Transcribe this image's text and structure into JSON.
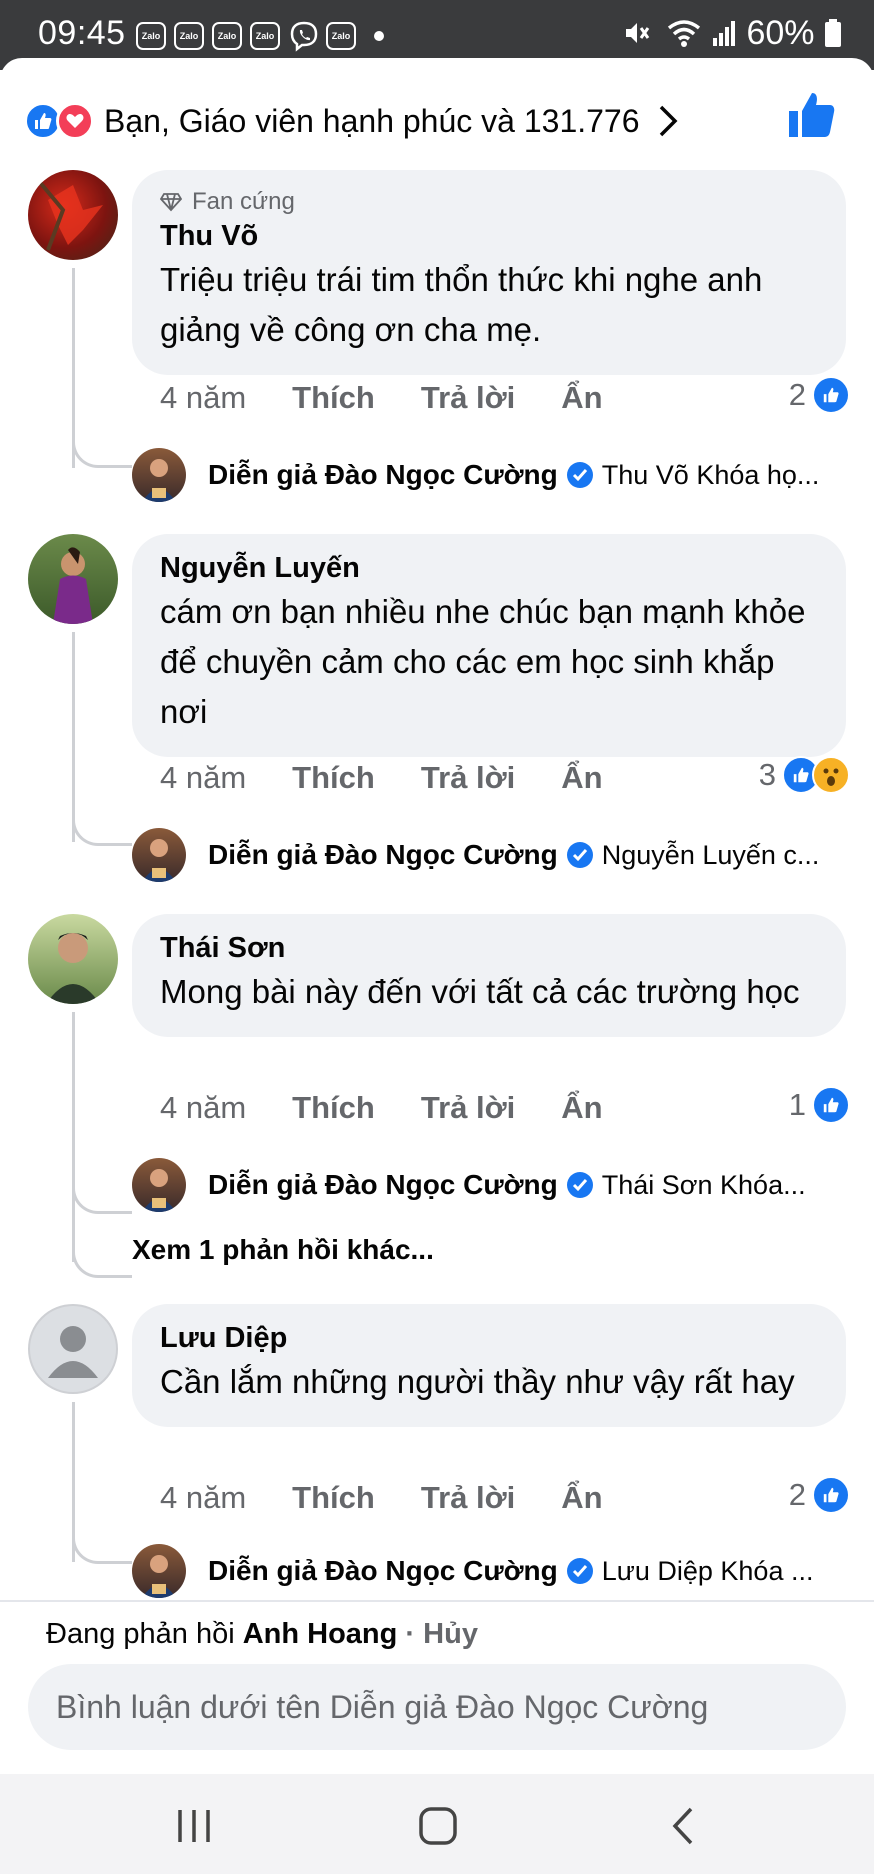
{
  "status": {
    "time": "09:45",
    "notif_icons": [
      "Zalo",
      "Zalo",
      "Zalo",
      "Zalo",
      "viber-icon",
      "Zalo"
    ],
    "battery": "60%"
  },
  "reactions_bar": {
    "text": "Bạn, Giáo viên hạnh phúc và 131.776"
  },
  "comments": [
    {
      "badge": "Fan cứng",
      "name": "Thu Võ",
      "body": "Triệu triệu trái tim thổn thức khi nghe anh giảng về công ơn cha mẹ.",
      "time": "4 năm",
      "like": "Thích",
      "reply": "Trả lời",
      "hide": "Ẩn",
      "count": "2",
      "reply_item": {
        "name": "Diễn giả Đào Ngọc Cường",
        "text": "Thu Võ Khóa họ..."
      }
    },
    {
      "name": "Nguyễn Luyến",
      "body": "cám ơn bạn nhiều nhe chúc bạn mạnh khỏe để chuyền cảm cho các em học sinh khắp nơi",
      "time": "4 năm",
      "like": "Thích",
      "reply": "Trả lời",
      "hide": "Ẩn",
      "count": "3",
      "reply_item": {
        "name": "Diễn giả Đào Ngọc Cường",
        "text": "Nguyễn Luyến c..."
      }
    },
    {
      "name": "Thái Sơn",
      "body": "Mong bài này đến với tất cả các trường học",
      "time": "4 năm",
      "like": "Thích",
      "reply": "Trả lời",
      "hide": "Ẩn",
      "count": "1",
      "reply_item": {
        "name": "Diễn giả Đào Ngọc Cường",
        "text": "Thái Sơn Khóa..."
      },
      "more": "Xem 1 phản hồi khác..."
    },
    {
      "name": "Lưu Diệp",
      "body": "Cần lắm những người thầy như vậy rất hay",
      "time": "4 năm",
      "like": "Thích",
      "reply": "Trả lời",
      "hide": "Ẩn",
      "count": "2",
      "reply_item": {
        "name": "Diễn giả Đào Ngọc Cường",
        "text": "Lưu Diệp Khóa ..."
      }
    }
  ],
  "composer": {
    "replying_prefix": "Đang phản hồi",
    "replying_to": "Anh Hoang",
    "separator": " · ",
    "cancel": "Hủy",
    "placeholder": "Bình luận dưới tên Diễn giả Đào Ngọc Cường"
  },
  "colors": {
    "brand": "#1877f2",
    "bubble": "#f0f2f5",
    "muted": "#65676b"
  }
}
